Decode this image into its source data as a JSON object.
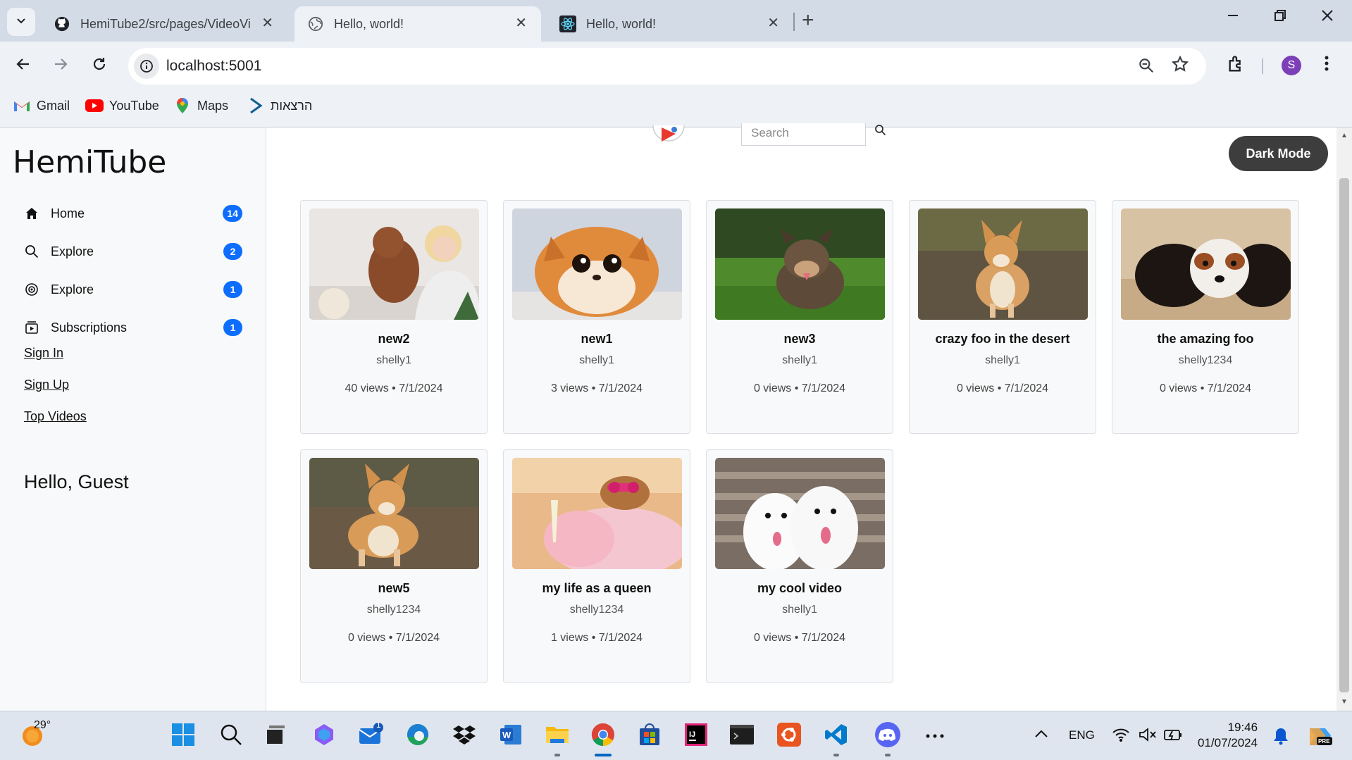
{
  "browser": {
    "tabs": [
      {
        "title": "HemiTube2/src/pages/VideoVi",
        "icon": "github-icon",
        "active": false
      },
      {
        "title": "Hello, world!",
        "icon": "globe-icon",
        "active": true
      },
      {
        "title": "Hello, world!",
        "icon": "react-icon",
        "active": false
      }
    ],
    "close_glyph": "✕",
    "new_tab_glyph": "+",
    "url": "localhost:5001",
    "profile_initial": "S",
    "bookmarks": [
      {
        "label": "Gmail",
        "icon": "gmail-icon"
      },
      {
        "label": "YouTube",
        "icon": "youtube-icon"
      },
      {
        "label": "Maps",
        "icon": "maps-icon"
      },
      {
        "label": "הרצאות",
        "icon": "lecture-icon"
      }
    ]
  },
  "sidebar": {
    "brand": "HemiTube",
    "nav": [
      {
        "label": "Home",
        "badge": "14",
        "icon": "home-icon"
      },
      {
        "label": "Explore",
        "badge": "2",
        "icon": "search-icon"
      },
      {
        "label": "Explore",
        "badge": "1",
        "icon": "compass-icon"
      },
      {
        "label": "Subscriptions",
        "badge": "1",
        "icon": "subscriptions-icon"
      }
    ],
    "links": [
      "Sign In",
      "Sign Up",
      "Top Videos"
    ],
    "greeting": "Hello, Guest"
  },
  "header": {
    "search_placeholder": "Search",
    "dark_mode_label": "Dark Mode"
  },
  "videos": [
    {
      "title": "new2",
      "author": "shelly1",
      "meta": "40 views • 7/1/2024",
      "thumb": "woman-with-poodle"
    },
    {
      "title": "new1",
      "author": "shelly1",
      "meta": "3 views • 7/1/2024",
      "thumb": "fluffy-pomeranian"
    },
    {
      "title": "new3",
      "author": "shelly1",
      "meta": "0 views • 7/1/2024",
      "thumb": "dog-on-grass"
    },
    {
      "title": "crazy foo in the desert",
      "author": "shelly1",
      "meta": "0 views • 7/1/2024",
      "thumb": "corgi-outdoors"
    },
    {
      "title": "the amazing foo",
      "author": "shelly1234",
      "meta": "0 views • 7/1/2024",
      "thumb": "cavalier-spaniel"
    },
    {
      "title": "new5",
      "author": "shelly1234",
      "meta": "0 views • 7/1/2024",
      "thumb": "corgi-standing"
    },
    {
      "title": "my life as a queen",
      "author": "shelly1234",
      "meta": "1 views • 7/1/2024",
      "thumb": "dog-in-bathrobe"
    },
    {
      "title": "my cool video",
      "author": "shelly1",
      "meta": "0 views • 7/1/2024",
      "thumb": "two-samoyeds"
    }
  ],
  "taskbar": {
    "temperature": "29°",
    "mail_badge": "1",
    "language": "ENG",
    "time": "19:46",
    "date": "01/07/2024"
  },
  "colors": {
    "badge": "#0d6efd",
    "dark_button": "#3d3d3d",
    "profile": "#7d3fb8"
  }
}
